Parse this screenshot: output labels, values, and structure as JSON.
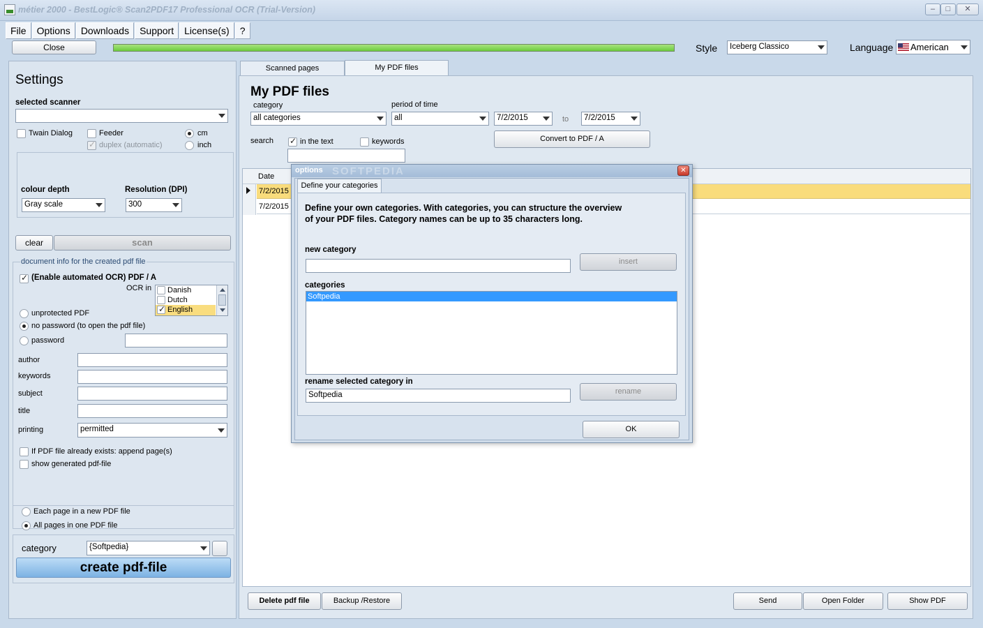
{
  "window": {
    "title": "métier 2000 - BestLogic® Scan2PDF17 Professional OCR (Trial-Version)",
    "minimize": "–",
    "maximize": "□",
    "close": "✕"
  },
  "menu": [
    "File",
    "Options",
    "Downloads",
    "Support",
    "License(s)",
    "?"
  ],
  "toolbar": {
    "close_label": "Close",
    "progress": 1.0,
    "style_label": "Style",
    "style_value": "Iceberg Classico",
    "language_label": "Language",
    "language_value": "American"
  },
  "settings": {
    "heading": "Settings",
    "scanner_label": "selected scanner",
    "scanner_value": "",
    "twain_label": "Twain Dialog",
    "feeder_label": "Feeder",
    "duplex_label": "duplex (automatic)",
    "cm_label": "cm",
    "inch_label": "inch",
    "colour_depth_label": "colour depth",
    "colour_depth_value": "Gray scale",
    "resolution_label": "Resolution (DPI)",
    "resolution_value": "300",
    "clear_label": "clear",
    "scan_label": "scan",
    "doc_info_legend": "document info for the created pdf file",
    "ocr_enable_label": "(Enable automated OCR) PDF / A",
    "ocr_in_label": "OCR in",
    "ocr_languages": [
      {
        "name": "Danish",
        "checked": false
      },
      {
        "name": "Dutch",
        "checked": false
      },
      {
        "name": "English",
        "checked": true
      }
    ],
    "unprotected_label": "unprotected PDF",
    "no_password_label": "no password (to open the pdf file)",
    "password_label": "password",
    "author_label": "author",
    "keywords_label": "keywords",
    "subject_label": "subject",
    "title_label": "title",
    "printing_label": "printing",
    "printing_value": "permitted",
    "append_label": "If PDF file already exists: append page(s)",
    "show_generated_label": "show generated pdf-file",
    "each_page_label": "Each page in a new PDF file",
    "all_pages_label": "All pages in one PDF file",
    "category_label": "category",
    "category_value": "{Softpedia}",
    "create_label": "create pdf-file"
  },
  "tabs": [
    "Scanned pages",
    "My PDF files"
  ],
  "pdf_files": {
    "heading": "My PDF files",
    "category_label": "category",
    "category_value": "all categories",
    "period_label": "period of time",
    "period_value": "all",
    "date_from": "7/2/2015",
    "to_label": "to",
    "date_to": "7/2/2015",
    "search_label": "search",
    "in_text_label": "in the text",
    "keywords_label": "keywords",
    "convert_label": "Convert to PDF / A",
    "grid_header": "Date",
    "grid_rows": [
      "7/2/2015",
      "7/2/2015"
    ],
    "delete_label": "Delete pdf file",
    "backup_label": "Backup /Restore",
    "send_label": "Send",
    "open_folder_label": "Open Folder",
    "show_pdf_label": "Show PDF"
  },
  "dialog": {
    "title": "options",
    "tab_label": "Define your categories",
    "description_line1": "Define your own categories. With categories, you can structure the overview",
    "description_line2": "of your PDF files. Category names can be up to 35 characters long.",
    "new_category_label": "new category",
    "insert_label": "insert",
    "categories_label": "categories",
    "categories": [
      "Softpedia"
    ],
    "rename_label": "rename selected category in",
    "rename_value": "Softpedia",
    "rename_button": "rename",
    "ok_label": "OK",
    "watermark": "SOFTPEDIA"
  }
}
